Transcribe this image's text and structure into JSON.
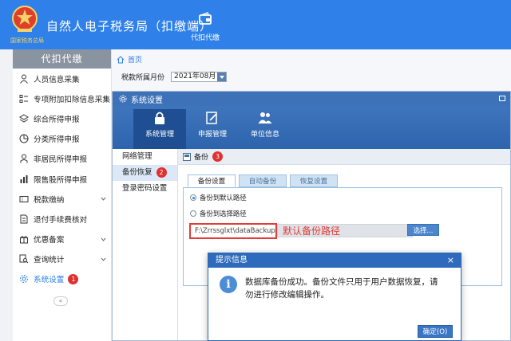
{
  "header": {
    "emblem_text": "国家税务总局",
    "app_title": "自然人电子税务局（扣缴端）",
    "tab_label": "代扣代缴",
    "brand_color": "#2f80e8"
  },
  "sidebar": {
    "heading": "代扣代缴",
    "items": [
      {
        "label": "人员信息采集",
        "icon": "person-icon"
      },
      {
        "label": "专项附加扣除信息采集",
        "icon": "list-icon"
      },
      {
        "label": "综合所得申报",
        "icon": "layers-icon"
      },
      {
        "label": "分类所得申报",
        "icon": "pie-icon"
      },
      {
        "label": "非居民所得申报",
        "icon": "person-outline-icon"
      },
      {
        "label": "限售股所得申报",
        "icon": "bar-chart-icon"
      },
      {
        "label": "税款缴纳",
        "icon": "ticket-icon"
      },
      {
        "label": "退付手续费核对",
        "icon": "document-icon"
      },
      {
        "label": "优惠备案",
        "icon": "gift-icon"
      },
      {
        "label": "查询统计",
        "icon": "search-doc-icon"
      },
      {
        "label": "系统设置",
        "icon": "gear-icon",
        "badge": "1"
      }
    ],
    "collapse_label": "«"
  },
  "main": {
    "breadcrumb": "首页",
    "period_label": "税款所属月份",
    "period_value": "2021年08月"
  },
  "settings_window": {
    "title": "系统设置",
    "tabs": [
      {
        "label": "系统管理",
        "active": true
      },
      {
        "label": "申报管理"
      },
      {
        "label": "单位信息"
      }
    ],
    "left_nav": [
      {
        "label": "网络管理"
      },
      {
        "label": "备份恢复",
        "badge": "2",
        "active": true
      },
      {
        "label": "登录密码设置"
      }
    ],
    "section_title": "备份",
    "section_badge": "3",
    "backup_tabs": [
      {
        "label": "备份设置",
        "active": true
      },
      {
        "label": "自动备份"
      },
      {
        "label": "恢复设置"
      }
    ],
    "radio_default": "备份到默认路径",
    "radio_choose": "备份到选择路径",
    "path_value": "F:\\Zrrssglxt\\dataBackup",
    "path_annotation": "默认备份路径",
    "choose_button": "选择..."
  },
  "dialog": {
    "title": "提示信息",
    "close": "×",
    "message": "数据库备份成功。备份文件只用于用户数据恢复，请勿进行修改编辑操作。",
    "ok_button": "确定(O)"
  }
}
